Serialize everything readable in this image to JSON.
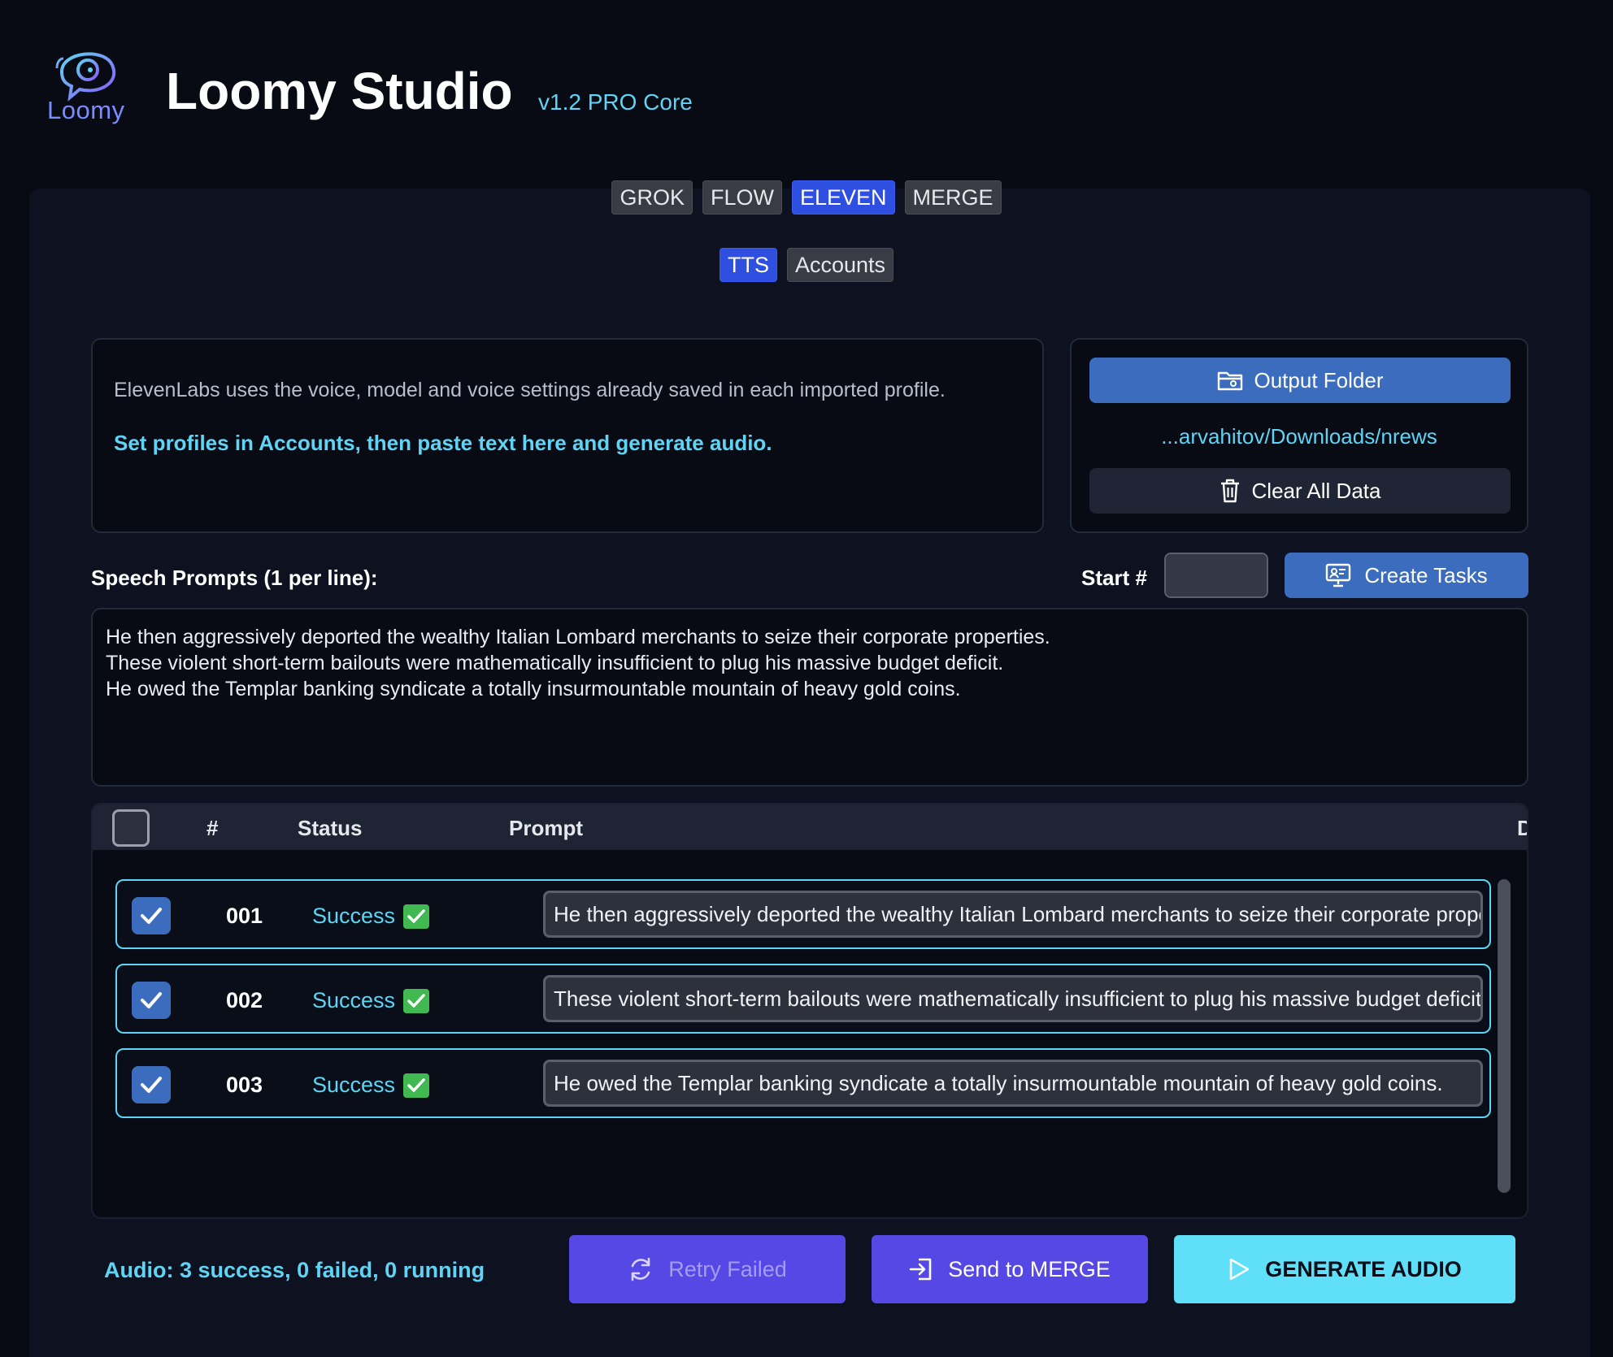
{
  "app": {
    "logo_text": "Loomy",
    "title": "Loomy Studio",
    "version": "v1.2 PRO Core"
  },
  "tabs": [
    {
      "label": "GROK",
      "active": false
    },
    {
      "label": "FLOW",
      "active": false
    },
    {
      "label": "ELEVEN",
      "active": true
    },
    {
      "label": "MERGE",
      "active": false
    }
  ],
  "sub_tabs": [
    {
      "label": "TTS",
      "active": true
    },
    {
      "label": "Accounts",
      "active": false
    }
  ],
  "info": {
    "line1": "ElevenLabs uses the voice, model and voice settings already saved in each imported profile.",
    "line2": "Set profiles in Accounts, then paste text here and generate audio."
  },
  "folder": {
    "output_label": "Output Folder",
    "path": "...arvahitov/Downloads/nrews",
    "clear_label": "Clear All Data"
  },
  "prompts": {
    "label": "Speech Prompts (1 per line):",
    "start_label": "Start #",
    "start_value": "",
    "create_label": "Create Tasks",
    "lines": [
      "He then aggressively deported the wealthy Italian Lombard merchants to seize their corporate properties.",
      "These violent short-term bailouts were mathematically insufficient to plug his massive budget deficit.",
      "He owed the Templar banking syndicate a totally insurmountable mountain of heavy gold coins."
    ]
  },
  "table": {
    "headers": {
      "num": "#",
      "status": "Status",
      "prompt": "Prompt",
      "extra": "D"
    },
    "rows": [
      {
        "num": "001",
        "status": "Success",
        "prompt": "He then aggressively deported the wealthy Italian Lombard merchants to seize their corporate properties."
      },
      {
        "num": "002",
        "status": "Success",
        "prompt": "These violent short-term bailouts were mathematically insufficient to plug his massive budget deficit."
      },
      {
        "num": "003",
        "status": "Success",
        "prompt": "He owed the Templar banking syndicate a totally insurmountable mountain of heavy gold coins."
      }
    ]
  },
  "footer": {
    "audio_status": "Audio: 3 success, 0 failed, 0 running",
    "retry_label": "Retry Failed",
    "send_label": "Send to MERGE",
    "generate_label": "GENERATE AUDIO"
  },
  "colors": {
    "accent_cyan": "#5fd4f4",
    "tab_active": "#2e4fe0",
    "button_blue": "#3b6cbd",
    "button_purple": "#5648e4",
    "success_green": "#3fb950"
  }
}
